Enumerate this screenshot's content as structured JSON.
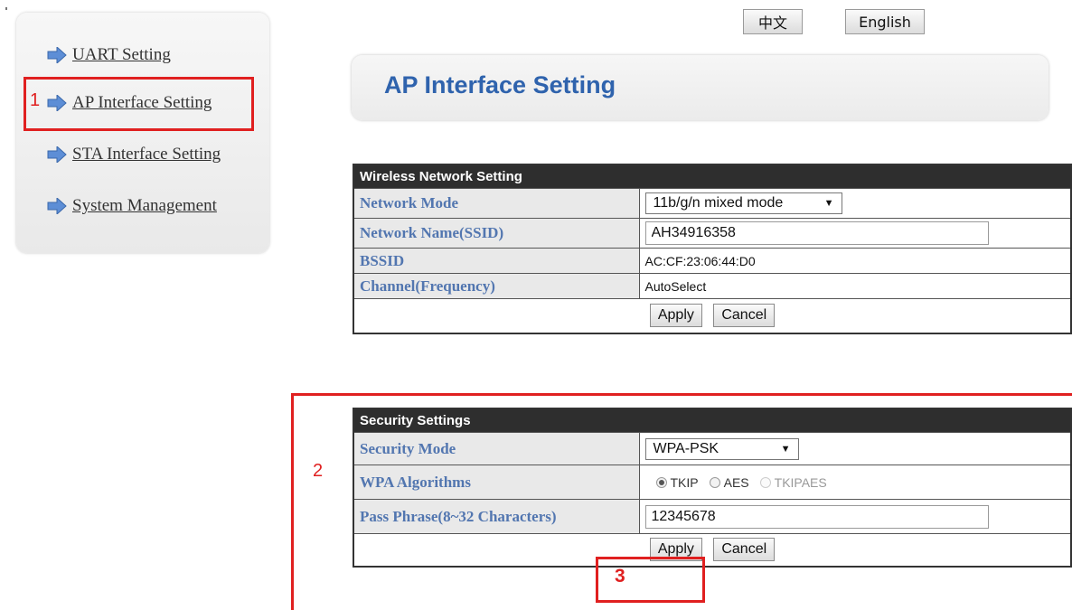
{
  "sidebar": {
    "items": [
      {
        "label": "UART Setting"
      },
      {
        "label": "AP Interface Setting"
      },
      {
        "label": "STA Interface Setting"
      },
      {
        "label": "System Management"
      }
    ]
  },
  "annotations": {
    "marker1": "1",
    "marker2": "2",
    "marker3": "3"
  },
  "language": {
    "chinese": "中文",
    "english": "English"
  },
  "page_title": "AP Interface Setting",
  "wireless": {
    "header": "Wireless Network Setting",
    "rows": {
      "mode_label": "Network Mode",
      "mode_value": "11b/g/n mixed mode",
      "ssid_label": "Network Name(SSID)",
      "ssid_value": "AH34916358",
      "bssid_label": "BSSID",
      "bssid_value": "AC:CF:23:06:44:D0",
      "channel_label": "Channel(Frequency)",
      "channel_value": "AutoSelect"
    },
    "apply": "Apply",
    "cancel": "Cancel"
  },
  "security": {
    "header": "Security Settings",
    "rows": {
      "mode_label": "Security Mode",
      "mode_value": "WPA-PSK",
      "algo_label": "WPA Algorithms",
      "algo_options": [
        "TKIP",
        "AES",
        "TKIPAES"
      ],
      "algo_selected": "TKIP",
      "pass_label": "Pass Phrase(8~32 Characters)",
      "pass_value": "12345678"
    },
    "apply": "Apply",
    "cancel": "Cancel"
  },
  "icons": {
    "nav_arrow": "arrow-right-icon",
    "dropdown": "caret-down-icon"
  },
  "colors": {
    "accent": "#2f63ad",
    "label": "#5276b0",
    "highlight": "#e02020",
    "header_bar": "#2e2e2e"
  }
}
